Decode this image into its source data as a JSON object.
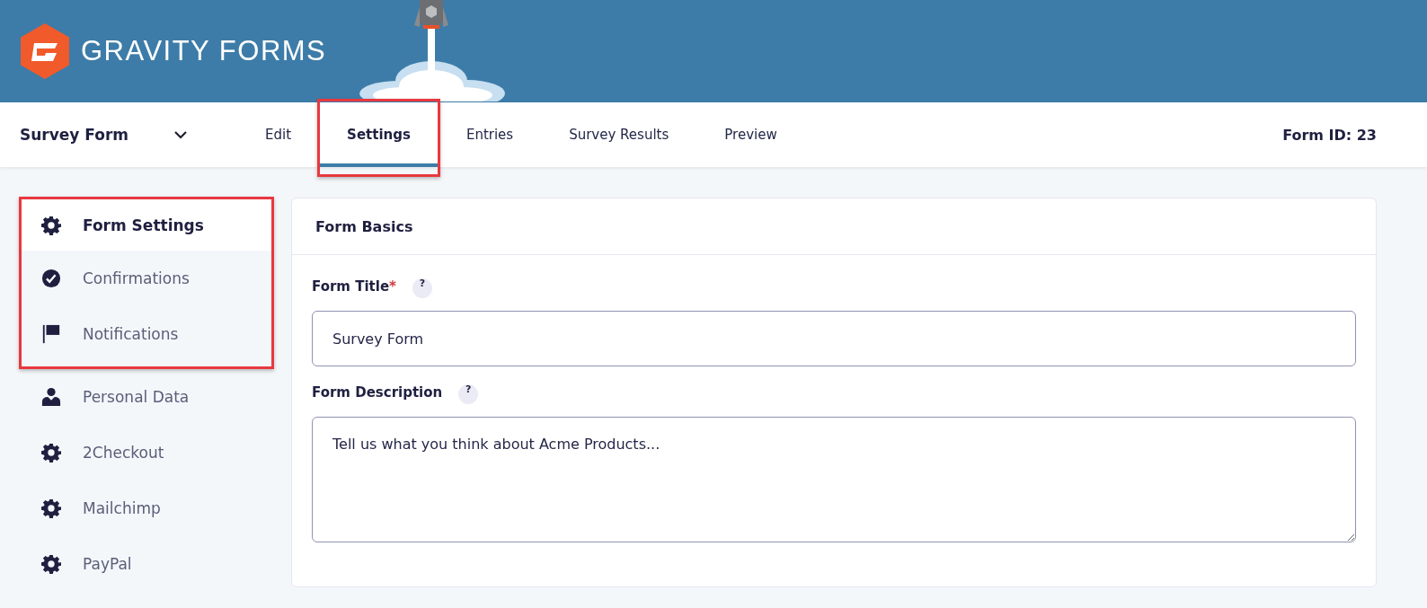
{
  "header": {
    "brand": "GRAVITY FORMS"
  },
  "form_switcher": {
    "label": "Survey Form"
  },
  "tabs": [
    {
      "label": "Edit",
      "selected": false,
      "highlighted": false
    },
    {
      "label": "Settings",
      "selected": true,
      "highlighted": true
    },
    {
      "label": "Entries",
      "selected": false,
      "highlighted": false
    },
    {
      "label": "Survey Results",
      "selected": false,
      "highlighted": false
    },
    {
      "label": "Preview",
      "selected": false,
      "highlighted": false
    }
  ],
  "form_id": "Form ID: 23",
  "sidebar": {
    "items": [
      {
        "label": "Form Settings",
        "kind": "gear",
        "selected": true,
        "highlighted": true
      },
      {
        "label": "Confirmations",
        "kind": "check",
        "selected": false,
        "highlighted": true
      },
      {
        "label": "Notifications",
        "kind": "flag",
        "selected": false,
        "highlighted": true
      },
      {
        "label": "Personal Data",
        "kind": "person",
        "selected": false,
        "highlighted": false
      },
      {
        "label": "2Checkout",
        "kind": "gear",
        "selected": false,
        "highlighted": false
      },
      {
        "label": "Mailchimp",
        "kind": "gear",
        "selected": false,
        "highlighted": false
      },
      {
        "label": "PayPal",
        "kind": "gear",
        "selected": false,
        "highlighted": false
      }
    ]
  },
  "panel": {
    "title": "Form Basics",
    "fields": [
      {
        "kind": "text",
        "label": "Form Title",
        "required_mark": "*",
        "help": "?",
        "value": "Survey Form"
      },
      {
        "kind": "textarea",
        "label": "Form Description",
        "help": "?",
        "value": "Tell us what you think about Acme Products..."
      }
    ]
  }
}
